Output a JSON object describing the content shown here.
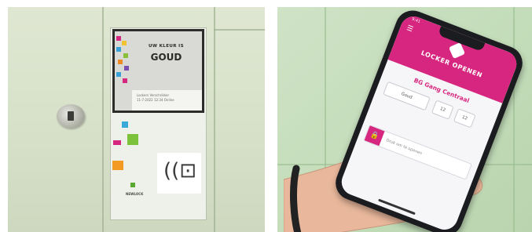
{
  "locker_photo": {
    "screen": {
      "line1": "UW KLEUR IS",
      "line2": "GOUD",
      "footer_line1": "Lockers Verschrikker",
      "footer_line2": "11-7-2022 12:34 Online"
    },
    "panel_brand": "NEWLOCK"
  },
  "phone_photo": {
    "app": {
      "status_time": "9:41",
      "title": "LOCKER OPENEN",
      "location": "BG Gang Centraal",
      "fields": [
        "Goud",
        "12",
        "12"
      ],
      "unlock_text": "Druk om te openen"
    },
    "colors": {
      "brand_pink": "#d6267f"
    }
  }
}
